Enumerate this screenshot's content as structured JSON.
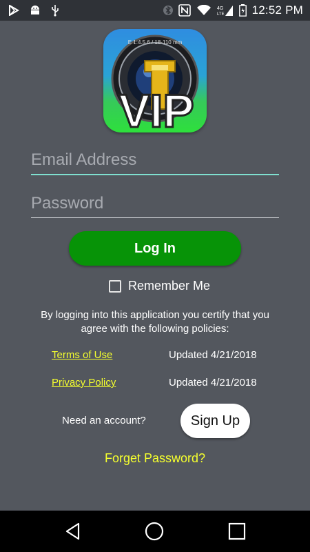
{
  "status_bar": {
    "time": "12:52 PM",
    "left_icons": [
      "play-store-icon",
      "android-icon",
      "usb-icon"
    ],
    "right_icons": [
      "bluetooth-icon",
      "nfc-icon",
      "wifi-icon",
      "lte-signal-icon",
      "battery-icon"
    ]
  },
  "app": {
    "logo_text": "VIP",
    "logo_lens_text": "E 1:4.5.6 / 18-110 mm"
  },
  "form": {
    "email_placeholder": "Email Address",
    "email_value": "",
    "password_placeholder": "Password",
    "password_value": "",
    "login_label": "Log In",
    "remember_label": "Remember Me",
    "remember_checked": false
  },
  "policies": {
    "intro": "By logging into this application you certify that you agree with the following policies:",
    "items": [
      {
        "label": "Terms of Use",
        "updated": "Updated 4/21/2018"
      },
      {
        "label": "Privacy Policy",
        "updated": "Updated 4/21/2018"
      }
    ]
  },
  "signup": {
    "prompt": "Need an account?",
    "button_label": "Sign Up"
  },
  "forget_password": "Forget Password?",
  "nav": {
    "buttons": [
      "back-icon",
      "home-icon",
      "recents-icon"
    ]
  },
  "colors": {
    "background": "#53575e",
    "login_button": "#079307",
    "link": "#f5ff2e",
    "email_underline": "#7fe0d0"
  }
}
